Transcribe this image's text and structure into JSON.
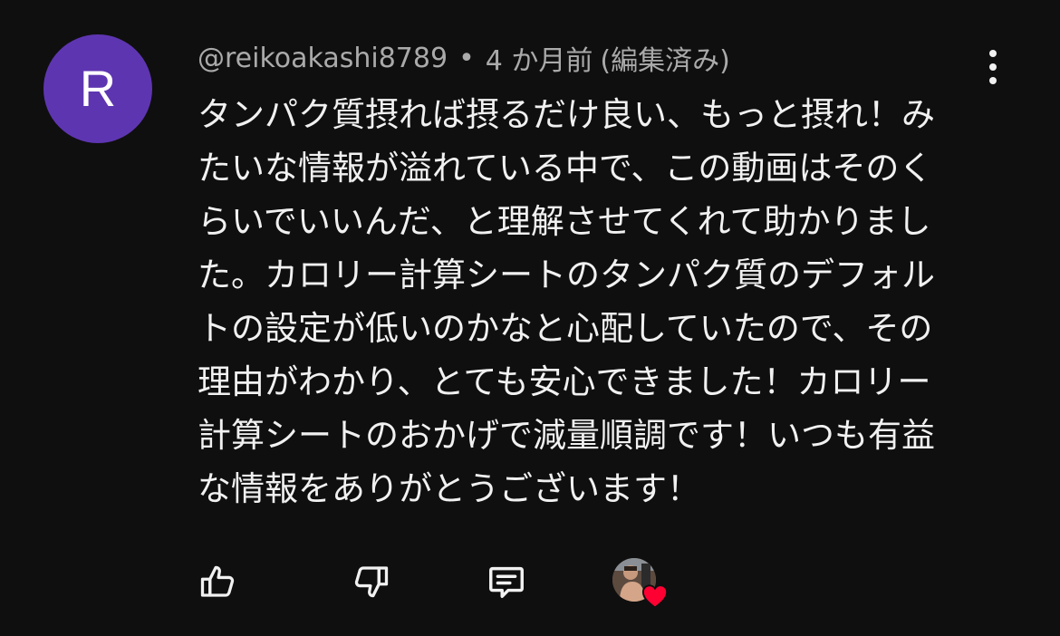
{
  "comment": {
    "avatar_letter": "R",
    "author": "@reikoakashi8789",
    "separator": "•",
    "timestamp": "4 か月前",
    "edited_label": "(編集済み)",
    "text": "タンパク質摂れば摂るだけ良い、もっと摂れ！み\nたいな情報が溢れている中で、この動画はそのく\nらいでいいんだ、と理解させてくれて助かりまし\nた。カロリー計算シートのタンパク質のデフォル\nトの設定が低いのかなと心配していたので、その\n理由がわかり、とても安心できました！カロリー\n計算シートのおかげで減量順調です！いつも有益\nな情報をありがとうございます！"
  },
  "actions": {
    "like_icon": "thumbs-up-icon",
    "dislike_icon": "thumbs-down-icon",
    "reply_icon": "comment-reply-icon",
    "creator_heart_icon": "heart-icon"
  },
  "colors": {
    "background": "#0f0f0f",
    "avatar_bg": "#5e35b1",
    "meta_text": "#aaaaaa",
    "body_text": "#f1f1f1",
    "heart": "#ff0033"
  }
}
